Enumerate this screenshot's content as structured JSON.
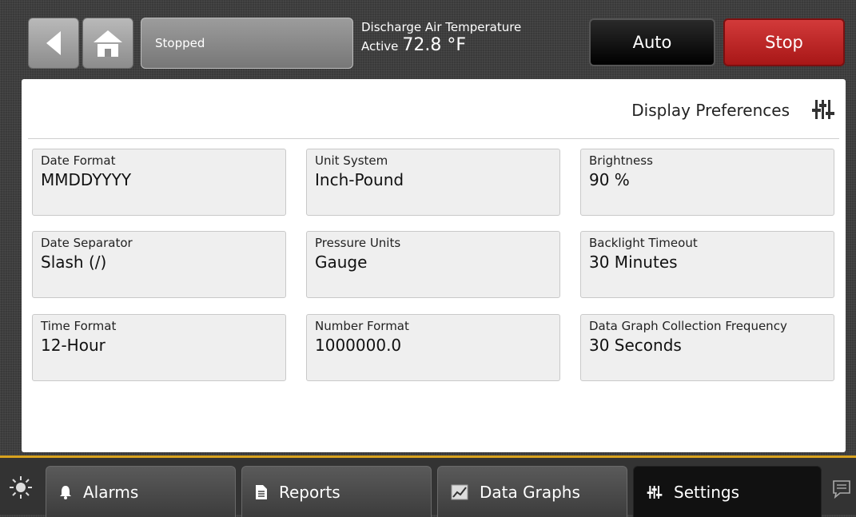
{
  "header": {
    "status": "Stopped",
    "discharge": {
      "label": "Discharge Air Temperature",
      "state": "Active",
      "value": "72.8 °F"
    },
    "auto_label": "Auto",
    "stop_label": "Stop",
    "icons": {
      "back": "back-arrow-icon",
      "home": "home-icon"
    }
  },
  "panel": {
    "title": "Display Preferences",
    "icon": "settings-sliders-icon",
    "settings": [
      {
        "label": "Date Format",
        "value": "MMDDYYYY"
      },
      {
        "label": "Unit System",
        "value": "Inch-Pound"
      },
      {
        "label": "Brightness",
        "value": "90 %"
      },
      {
        "label": "Date Separator",
        "value": "Slash (/)"
      },
      {
        "label": "Pressure Units",
        "value": "Gauge"
      },
      {
        "label": "Backlight Timeout",
        "value": "30 Minutes"
      },
      {
        "label": "Time Format",
        "value": "12-Hour"
      },
      {
        "label": "Number Format",
        "value": "1000000.0"
      },
      {
        "label": "Data Graph Collection Frequency",
        "value": "30 Seconds"
      }
    ]
  },
  "nav": {
    "tabs": [
      {
        "label": "Alarms",
        "icon": "bell-icon"
      },
      {
        "label": "Reports",
        "icon": "document-icon"
      },
      {
        "label": "Data Graphs",
        "icon": "graph-icon"
      },
      {
        "label": "Settings",
        "icon": "settings-sliders-icon",
        "active": true
      }
    ],
    "icons": {
      "brightness": "sun-icon",
      "messages": "chat-icon"
    }
  },
  "colors": {
    "accent_gold": "#d8a21e",
    "stop_red": "#b71d1d",
    "auto_black": "#000000"
  }
}
